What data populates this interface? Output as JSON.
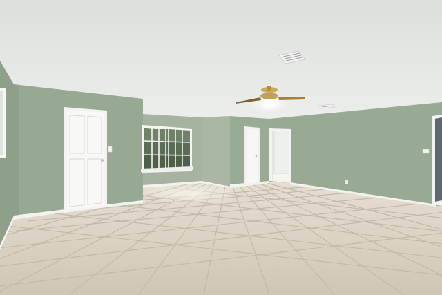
{
  "scene": {
    "colors": {
      "ceiling": "#e6e8e6",
      "ceiling_shadow": "#d4d7d5",
      "wall_main": "#96a791",
      "wall_light": "#a6b4a1",
      "wall_dark": "#88997f",
      "trim": "#f4f4f2",
      "door": "#f7f7f5",
      "floor": "#d9d2c4",
      "floor_grout": "#bfb6a5",
      "window_glass": "#5e6f56",
      "window_frame": "#f6f6f4"
    },
    "icons": [
      "ceiling-fan-icon",
      "air-vent-icon",
      "light-switch-icon",
      "power-outlet-icon"
    ]
  }
}
